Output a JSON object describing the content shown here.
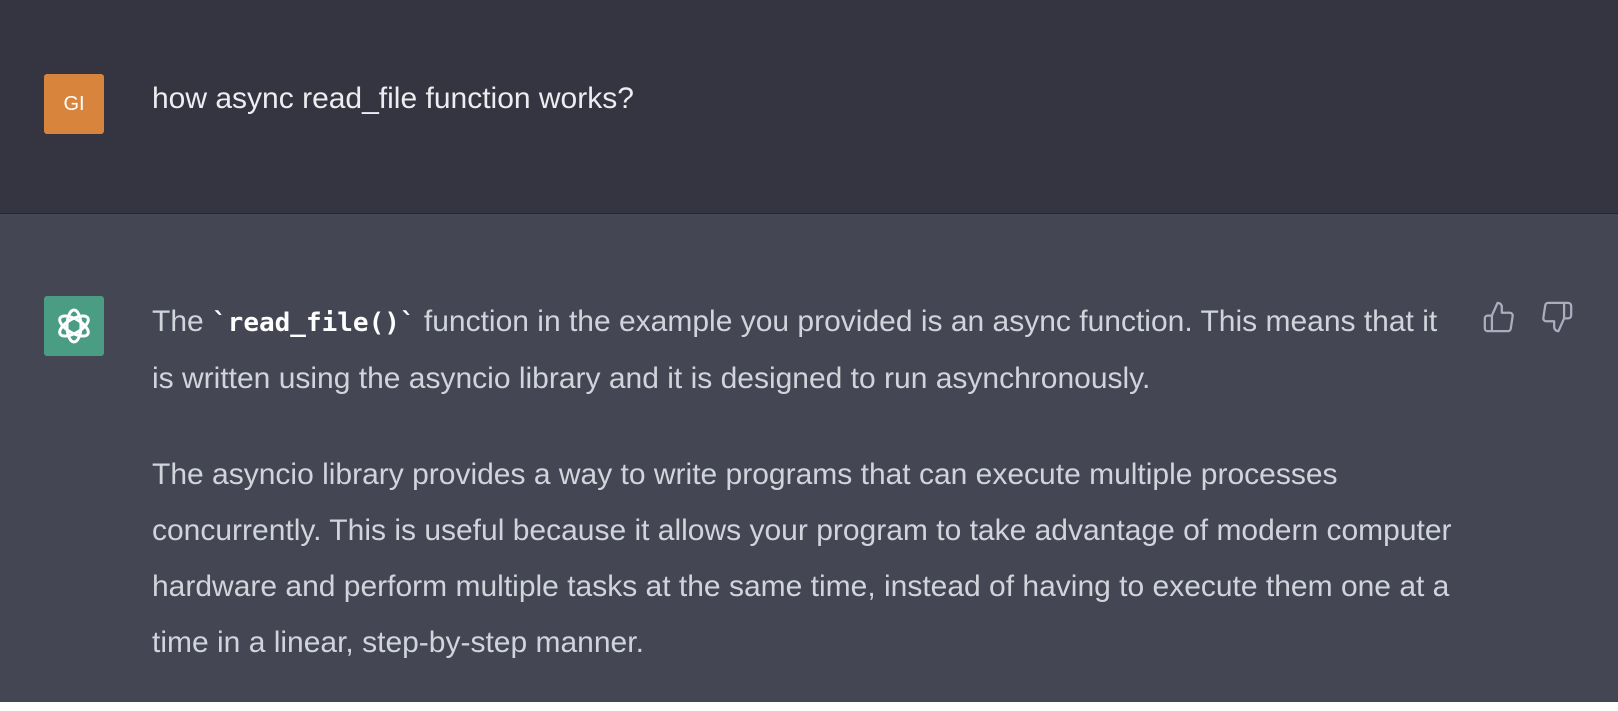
{
  "user_message": {
    "avatar_initials": "GI",
    "text": "how async read_file function works?"
  },
  "assistant_message": {
    "avatar_icon": "openai-logo-icon",
    "para1_before": "The ",
    "para1_code": "`read_file()`",
    "para1_after": " function in the example you provided is an async function. This means that it is written using the asyncio library and it is designed to run asynchronously.",
    "para2": "The asyncio library provides a way to write programs that can execute multiple processes concurrently. This is useful because it allows your program to take advantage of modern computer hardware and perform multiple tasks at the same time, instead of having to execute them one at a time in a linear, step-by-step manner."
  },
  "feedback": {
    "thumbs_up_icon": "thumbs-up-icon",
    "thumbs_down_icon": "thumbs-down-icon"
  },
  "colors": {
    "user_bg": "#343541",
    "assistant_bg": "#444654",
    "user_avatar": "#d9843c",
    "assistant_avatar": "#4a9d83"
  }
}
